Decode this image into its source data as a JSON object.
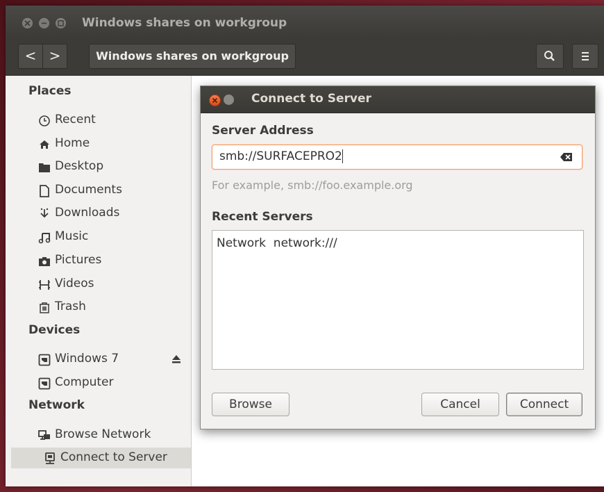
{
  "window": {
    "title": "Windows shares on workgroup",
    "path_label": "Windows shares on workgroup",
    "back_glyph": "<",
    "forward_glyph": ">"
  },
  "sidebar": {
    "places_header": "Places",
    "places": [
      {
        "label": "Recent",
        "icon": "clock-icon"
      },
      {
        "label": "Home",
        "icon": "home-icon"
      },
      {
        "label": "Desktop",
        "icon": "folder-icon"
      },
      {
        "label": "Documents",
        "icon": "document-icon"
      },
      {
        "label": "Downloads",
        "icon": "download-icon"
      },
      {
        "label": "Music",
        "icon": "music-icon"
      },
      {
        "label": "Pictures",
        "icon": "camera-icon"
      },
      {
        "label": "Videos",
        "icon": "film-icon"
      },
      {
        "label": "Trash",
        "icon": "trash-icon"
      }
    ],
    "devices_header": "Devices",
    "devices": [
      {
        "label": "Windows 7",
        "icon": "drive-icon"
      },
      {
        "label": "Computer",
        "icon": "drive-icon"
      }
    ],
    "network_header": "Network",
    "network": [
      {
        "label": "Browse Network",
        "icon": "network-icon"
      },
      {
        "label": "Connect to Server",
        "icon": "server-icon",
        "selected": true
      }
    ]
  },
  "dialog": {
    "title": "Connect to Server",
    "server_address_label": "Server Address",
    "server_address_value": "smb://SURFACEPRO2",
    "example_hint": "For example, smb://foo.example.org",
    "recent_servers_label": "Recent Servers",
    "recent_servers": [
      {
        "name": "Network",
        "uri": "network:///"
      }
    ],
    "browse_label": "Browse",
    "cancel_label": "Cancel",
    "connect_label": "Connect"
  },
  "colors": {
    "titlebar": "#3c3b37",
    "close_button": "#df4a16",
    "accent_focus": "#f0a070"
  }
}
